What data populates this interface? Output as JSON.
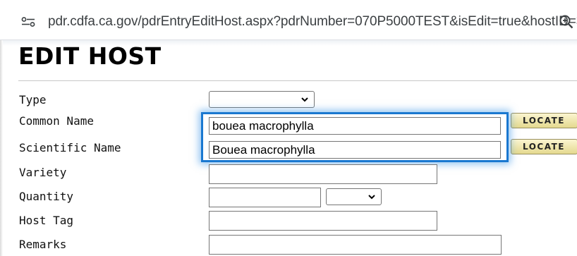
{
  "browser": {
    "url": "pdr.cdfa.ca.gov/pdrEntryEditHost.aspx?pdrNumber=070P5000TEST&isEdit=true&hostID=3..."
  },
  "page": {
    "title": "EDIT HOST"
  },
  "form": {
    "type_label": "Type",
    "type_value": "",
    "common_name_label": "Common Name",
    "common_name_value": "bouea macrophylla",
    "scientific_name_label": "Scientific Name",
    "scientific_name_value": "Bouea macrophylla",
    "variety_label": "Variety",
    "variety_value": "",
    "quantity_label": "Quantity",
    "quantity_value": "",
    "quantity_unit_value": "",
    "host_tag_label": "Host Tag",
    "host_tag_value": "",
    "remarks_label": "Remarks",
    "remarks_value": "",
    "locate_label": "LOCATE"
  },
  "colors": {
    "highlight": "#1a78d0",
    "locate_button": "#efe6a8"
  },
  "icons": {
    "site": "site-settings-icon",
    "zoom": "zoom-icon",
    "dropdown": "chevron-down-icon"
  }
}
